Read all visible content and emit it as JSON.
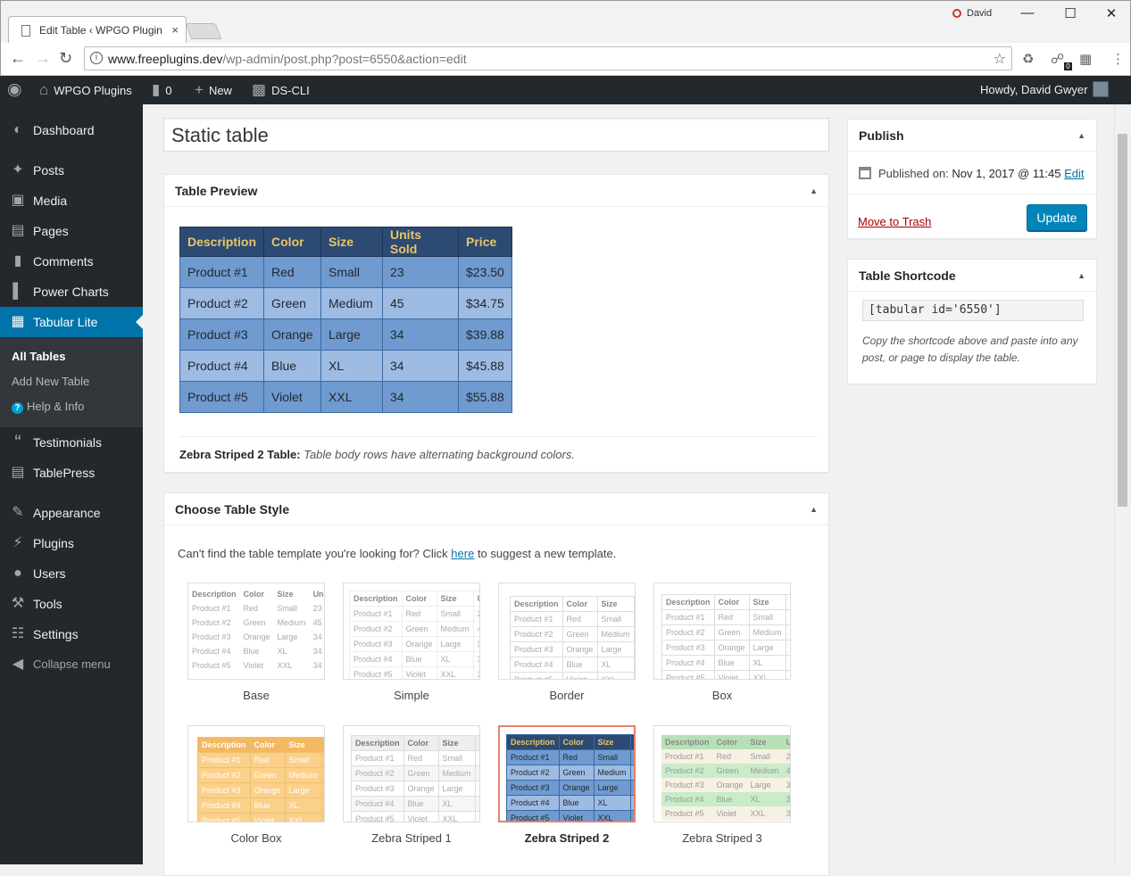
{
  "browser": {
    "tab_title": "Edit Table ‹ WPGO Plugin",
    "tab_close": "×",
    "profile_name": "David",
    "url_host": "www.freeplugins.dev",
    "url_path": "/wp-admin/post.php?post=6550&action=edit",
    "ext_badge": "0"
  },
  "adminbar": {
    "site_name": "WPGO Plugins",
    "comments_count": "0",
    "new_label": "New",
    "dscli_label": "DS-CLI",
    "howdy": "Howdy, David Gwyer"
  },
  "sidebar": {
    "items": [
      {
        "label": "Dashboard",
        "icon": "dashboard-icon"
      },
      {
        "label": "Posts",
        "icon": "pin-icon"
      },
      {
        "label": "Media",
        "icon": "media-icon"
      },
      {
        "label": "Pages",
        "icon": "pages-icon"
      },
      {
        "label": "Comments",
        "icon": "comment-icon"
      },
      {
        "label": "Power Charts",
        "icon": "bar-chart-icon"
      },
      {
        "label": "Tabular Lite",
        "icon": "table-icon"
      },
      {
        "label": "Testimonials",
        "icon": "quote-icon"
      },
      {
        "label": "TablePress",
        "icon": "tablepress-icon"
      },
      {
        "label": "Appearance",
        "icon": "brush-icon"
      },
      {
        "label": "Plugins",
        "icon": "plug-icon"
      },
      {
        "label": "Users",
        "icon": "users-icon"
      },
      {
        "label": "Tools",
        "icon": "wrench-icon"
      },
      {
        "label": "Settings",
        "icon": "settings-icon"
      },
      {
        "label": "Collapse menu",
        "icon": "collapse-icon"
      }
    ],
    "submenu": [
      "All Tables",
      "Add New Table",
      "Help & Info"
    ],
    "help_badge": "?"
  },
  "post_title": "Static table",
  "preview": {
    "heading": "Table Preview",
    "columns": [
      "Description",
      "Color",
      "Size",
      "Units Sold",
      "Price"
    ],
    "rows": [
      [
        "Product #1",
        "Red",
        "Small",
        "23",
        "$23.50"
      ],
      [
        "Product #2",
        "Green",
        "Medium",
        "45",
        "$34.75"
      ],
      [
        "Product #3",
        "Orange",
        "Large",
        "34",
        "$39.88"
      ],
      [
        "Product #4",
        "Blue",
        "XL",
        "34",
        "$45.88"
      ],
      [
        "Product #5",
        "Violet",
        "XXL",
        "34",
        "$55.88"
      ]
    ],
    "note_title": "Zebra Striped 2 Table:",
    "note_text": "Table body rows have alternating background colors."
  },
  "choose": {
    "heading": "Choose Table Style",
    "intro_before": "Can't find the table template you're looking for? Click ",
    "intro_link": "here",
    "intro_after": " to suggest a new template.",
    "templates": [
      "Base",
      "Simple",
      "Border",
      "Box",
      "Color Box",
      "Zebra Striped 1",
      "Zebra Striped 2",
      "Zebra Striped 3"
    ],
    "selected": "Zebra Striped 2",
    "thumb_headers": [
      "Description",
      "Color",
      "Size",
      "Uni"
    ],
    "thumb_rows": [
      [
        "Product #1",
        "Red",
        "Small",
        "23"
      ],
      [
        "Product #2",
        "Green",
        "Medium",
        "45"
      ],
      [
        "Product #3",
        "Orange",
        "Large",
        "34"
      ],
      [
        "Product #4",
        "Blue",
        "XL",
        "34"
      ],
      [
        "Product #5",
        "Violet",
        "XXL",
        "34"
      ]
    ]
  },
  "publish": {
    "heading": "Publish",
    "published_label": "Published on:",
    "published_date": "Nov 1, 2017 @ 11:45",
    "edit_link": "Edit",
    "trash_link": "Move to Trash",
    "update_button": "Update"
  },
  "shortcode": {
    "heading": "Table Shortcode",
    "value": "[tabular id='6550']",
    "description": "Copy the shortcode above and paste into any post, or page to display the table."
  },
  "colors": {
    "accent": "#0073aa",
    "header_bg": "#2c4a72",
    "header_text": "#e8c56a",
    "row_odd": "#6f9bd1",
    "row_even": "#9ebbe3"
  }
}
